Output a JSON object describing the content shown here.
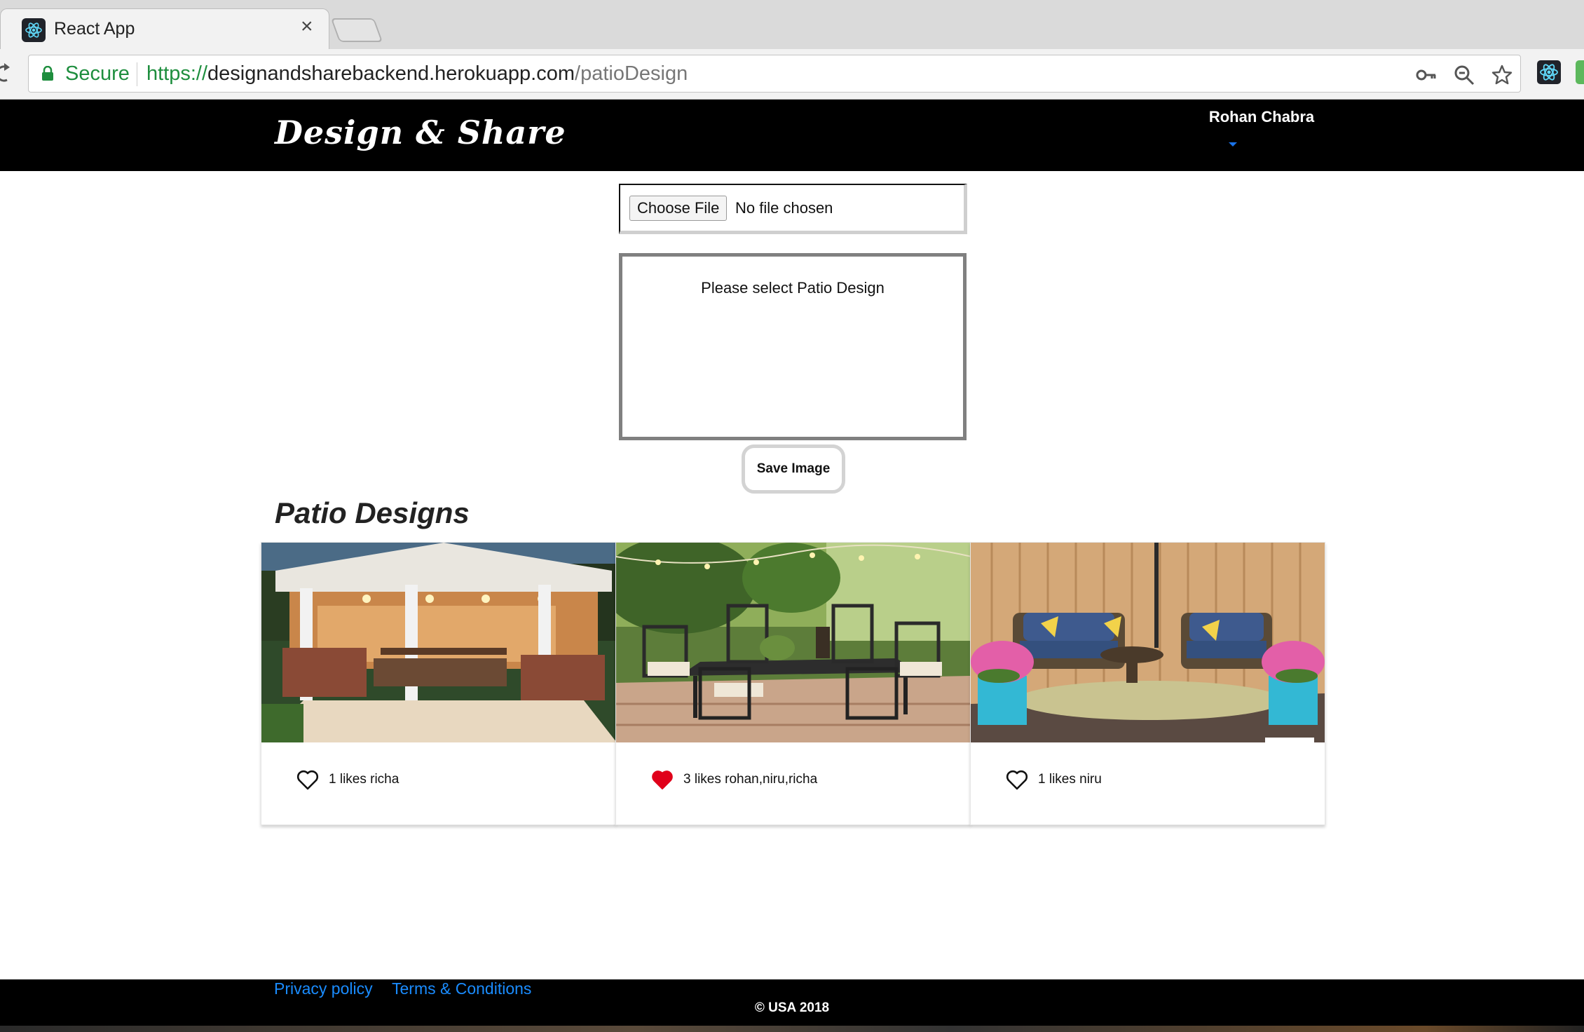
{
  "browser": {
    "tab_title": "React App",
    "tab_close": "×",
    "secure_label": "Secure",
    "url_scheme": "https://",
    "url_host": "designandsharebackend.herokuapp.com",
    "url_path": "/patioDesign",
    "icons": [
      "react-favicon-icon",
      "reload-icon",
      "lock-icon",
      "key-icon",
      "zoom-icon",
      "star-icon",
      "react-devtools-icon",
      "extension-icon"
    ]
  },
  "navbar": {
    "brand": "Design & Share",
    "user_name": "Rohan Chabra"
  },
  "upload": {
    "choose_file_label": "Choose File",
    "file_status": "No file chosen",
    "preview_message": "Please select Patio Design",
    "save_label": "Save Image"
  },
  "gallery": {
    "title": "Patio Designs",
    "cards": [
      {
        "likes_text": "1 likes richa",
        "liked": false,
        "image": "covered-patio-pavilion"
      },
      {
        "likes_text": "3 likes rohan,niru,richa",
        "liked": true,
        "image": "garden-dining-set"
      },
      {
        "likes_text": "1 likes niru",
        "liked": false,
        "image": "wicker-sofa-deck"
      }
    ]
  },
  "footer": {
    "privacy": "Privacy policy",
    "terms": "Terms & Conditions",
    "copyright": "© USA 2018"
  },
  "colors": {
    "navbar_bg": "#000000",
    "link_blue": "#1a8cff",
    "liked_heart": "#e0001a",
    "secure_green": "#1e8e3e"
  }
}
